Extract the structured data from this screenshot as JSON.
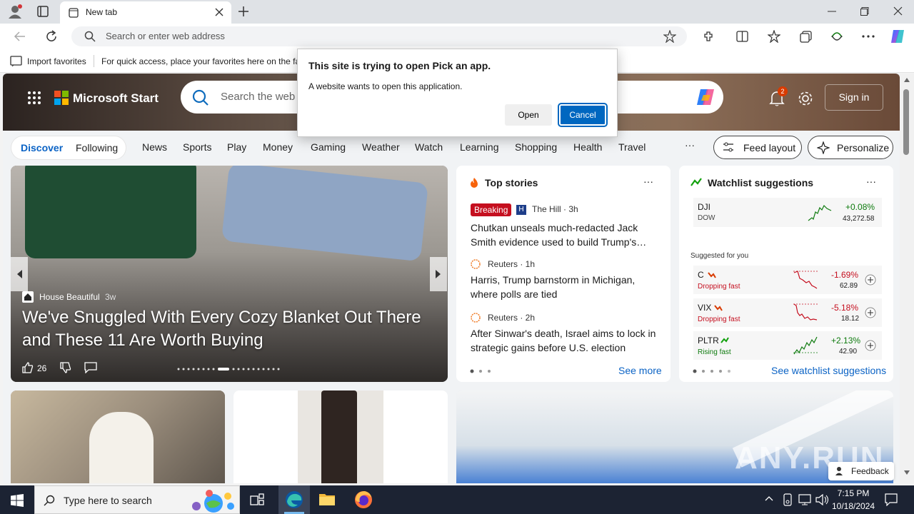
{
  "browser": {
    "tab_title": "New tab",
    "address_placeholder": "Search or enter web address",
    "favorites": {
      "import_label": "Import favorites",
      "hint": "For quick access, place your favorites here on the favorites bar."
    }
  },
  "page": {
    "brand": "Microsoft Start",
    "search_placeholder": "Search the web",
    "notification_count": "2",
    "sign_in": "Sign in",
    "pivots": [
      "Discover",
      "Following"
    ],
    "nav": [
      "News",
      "Sports",
      "Play",
      "Money",
      "Gaming",
      "Weather",
      "Watch",
      "Learning",
      "Shopping",
      "Health",
      "Travel"
    ],
    "more": "···",
    "feed_layout": "Feed layout",
    "personalize": "Personalize",
    "hero_article": {
      "source": "House Beautiful",
      "age": "3w",
      "title": "We've Snuggled With Every Cozy Blanket Out There and These 11 Are Worth Buying",
      "likes": "26"
    },
    "top_stories": {
      "title": "Top stories",
      "items": [
        {
          "badge": "Breaking",
          "source": "The Hill · 3h",
          "headline": "Chutkan unseals much-redacted Jack Smith evidence used to build Trump's…"
        },
        {
          "source": "Reuters · 1h",
          "headline": "Harris, Trump barnstorm in Michigan, where polls are tied"
        },
        {
          "source": "Reuters · 2h",
          "headline": "After Sinwar's death, Israel aims to lock in strategic gains before U.S. election"
        }
      ],
      "see_more": "See more"
    },
    "watchlist": {
      "title": "Watchlist suggestions",
      "dji": {
        "symbol": "DJI",
        "name": "DOW",
        "change": "+0.08%",
        "price": "43,272.58"
      },
      "suggested_label": "Suggested for you",
      "items": [
        {
          "symbol": "C",
          "status": "Dropping fast",
          "change": "-1.69%",
          "price": "62.89"
        },
        {
          "symbol": "VIX",
          "status": "Dropping fast",
          "change": "-5.18%",
          "price": "18.12"
        },
        {
          "symbol": "PLTR",
          "status": "Rising fast",
          "change": "+2.13%",
          "price": "42.90"
        }
      ],
      "see_suggestions": "See watchlist suggestions"
    },
    "feedback": "Feedback",
    "watermark": "ANY.RUN"
  },
  "dialog": {
    "title": "This site is trying to open Pick an app.",
    "message": "A website wants to open this application.",
    "open": "Open",
    "cancel": "Cancel"
  },
  "taskbar": {
    "search_placeholder": "Type here to search",
    "time": "7:15 PM",
    "date": "10/18/2024"
  },
  "colors": {
    "accent": "#0067c0",
    "down": "#c50f1f",
    "up": "#0f7b0f",
    "link": "#0b63c5"
  }
}
